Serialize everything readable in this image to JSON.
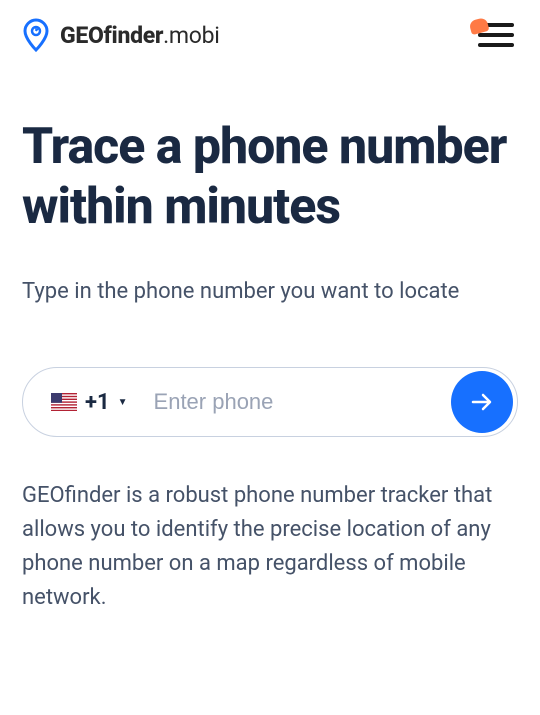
{
  "header": {
    "logo_bold": "GEOfinder",
    "logo_suffix": ".mobi"
  },
  "hero": {
    "title": "Trace a phone number within minutes",
    "subtitle": "Type in the phone number you want to locate"
  },
  "phone_input": {
    "country_code": "+1",
    "placeholder": "Enter phone",
    "value": ""
  },
  "description": "GEOfinder is a robust phone number tracker that allows you to identify the precise location of any phone number on a map regardless of mobile network."
}
